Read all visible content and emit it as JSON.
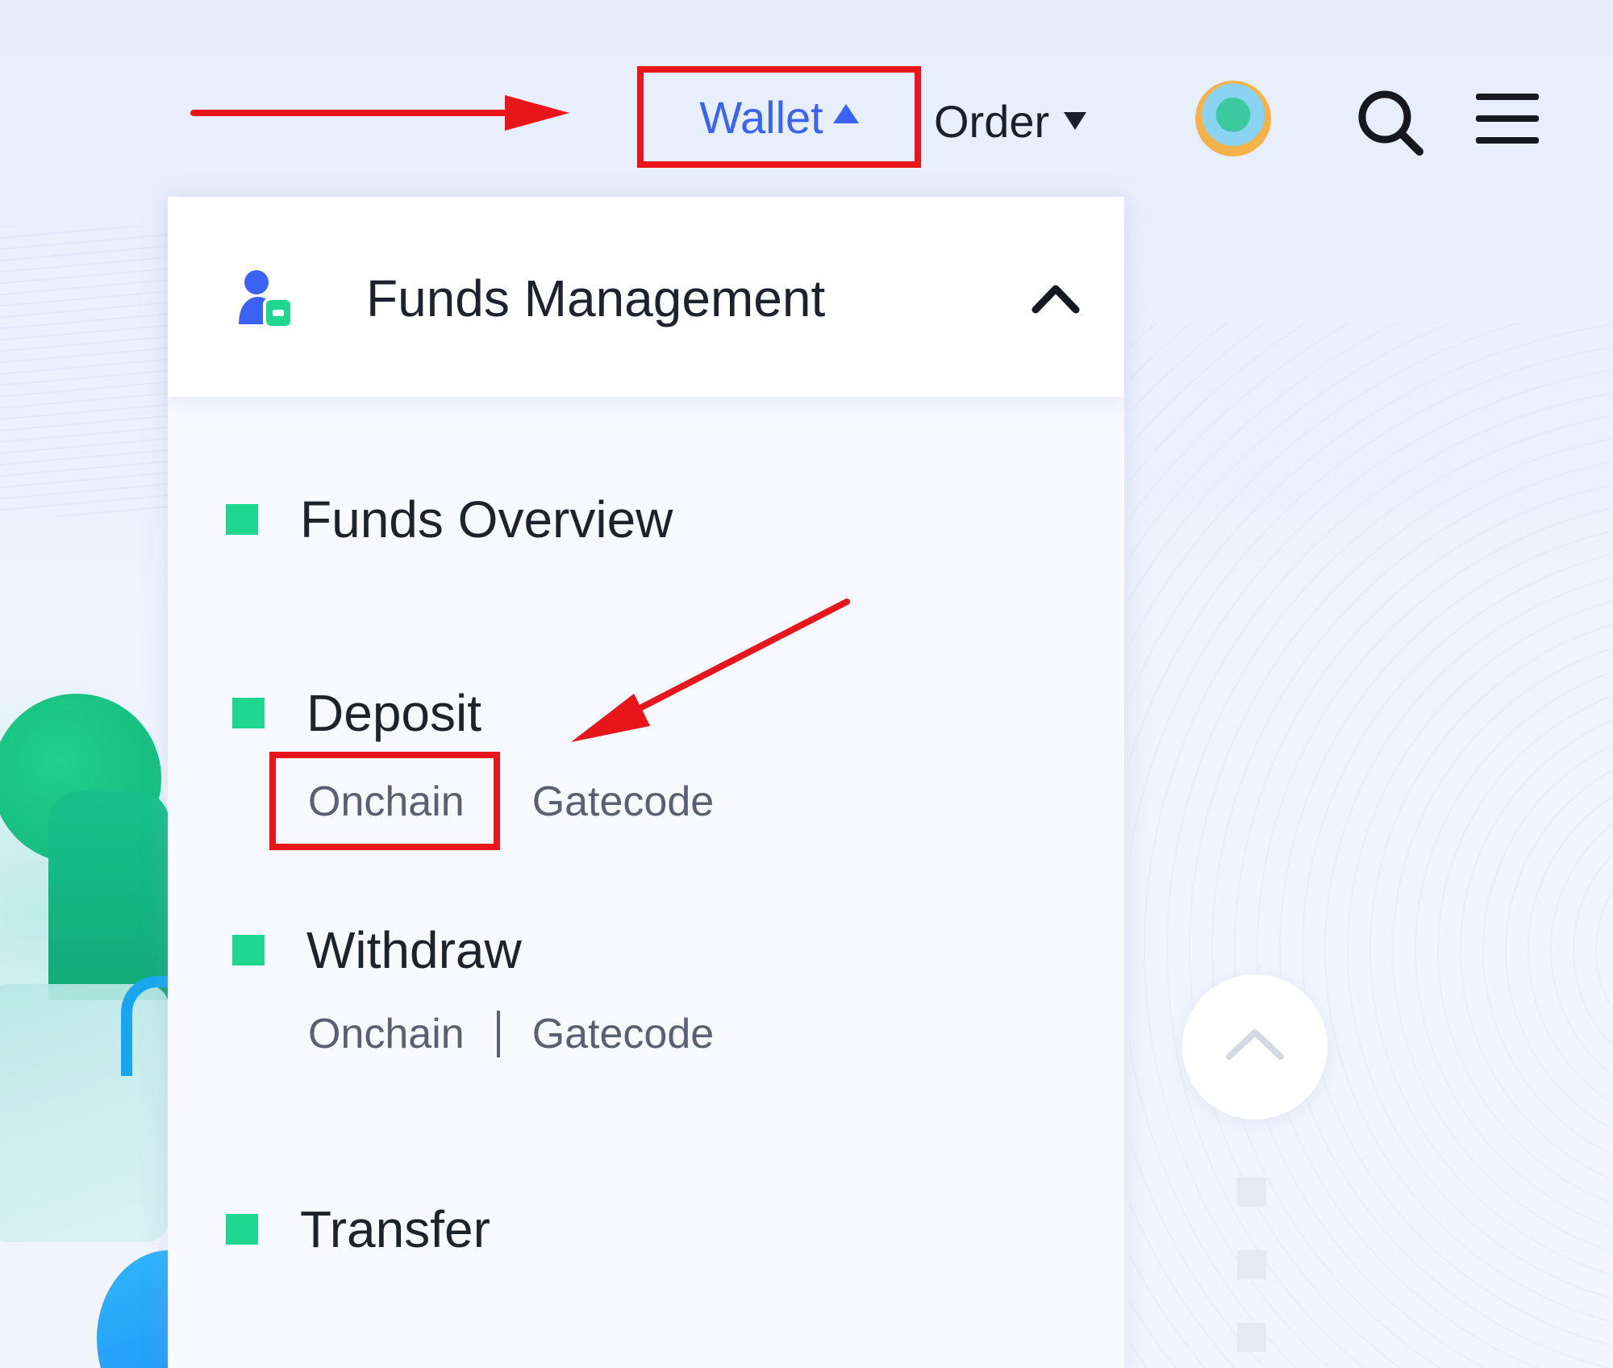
{
  "nav": {
    "wallet_label": "Wallet",
    "order_label": "Order",
    "icons": [
      "caret-up-icon",
      "caret-down-icon",
      "avatar",
      "search-icon",
      "menu-icon"
    ]
  },
  "panel": {
    "title": "Funds Management",
    "items": [
      {
        "label": "Funds Overview"
      },
      {
        "label": "Deposit",
        "links": [
          "Onchain",
          "Gatecode"
        ]
      },
      {
        "label": "Withdraw",
        "links": [
          "Onchain",
          "Gatecode"
        ]
      },
      {
        "label": "Transfer"
      }
    ]
  },
  "colors": {
    "accent_blue": "#3a63f5",
    "bullet_green": "#1fd68f",
    "annotation_red": "#e8161a"
  }
}
